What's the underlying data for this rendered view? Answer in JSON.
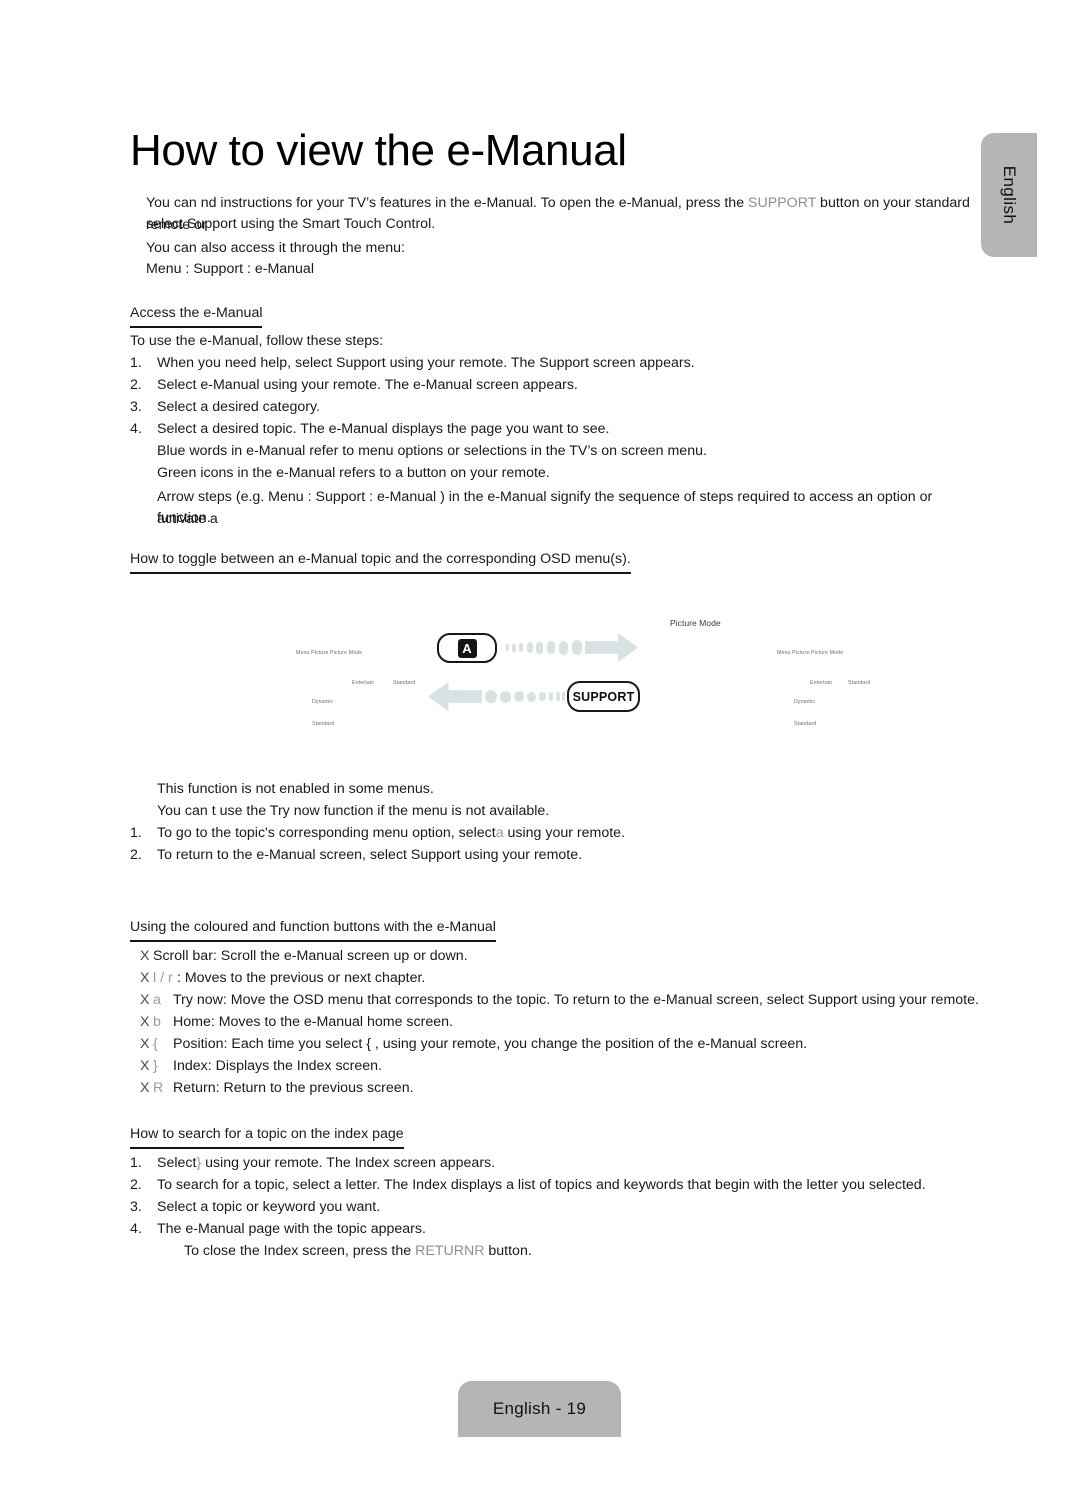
{
  "side_tab": {
    "label": "English"
  },
  "page_title": "How to view the e-Manual",
  "intro": {
    "line1_a": "You can  nd instructions for your TV",
    "line1_b": "s features in the e-Manual. To open the e-Manual, press the ",
    "line1_support": "SUPPORT",
    "line1_c": " button on your standard remote or",
    "line2": "select Support using the Smart Touch Control.",
    "line3": "You can also access it through the menu:",
    "line4": "Menu  : Support  : e-Manual"
  },
  "section_access": {
    "heading": "Access the  e-Manual",
    "lead": "To use the e-Manual, follow these steps:",
    "steps": [
      {
        "n": "1.",
        "text": "When you need help, select Support using your remote. The Support screen appears."
      },
      {
        "n": "2.",
        "text": "Select e-Manual using your remote. The e-Manual screen appears."
      },
      {
        "n": "3.",
        "text": "Select a desired category."
      },
      {
        "n": "4.",
        "text": "Select a desired topic. The e-Manual displays the page you want to see."
      }
    ],
    "notes": [
      "Blue words in e-Manual refer to menu options or selections in the TV’s on screen menu.",
      "Green icons in the e-Manual refers to a button on your remote."
    ],
    "arrow_note_line1": "Arrow steps (e.g. Menu : Support    : e-Manual  ) in the e-Manual signify the sequence of steps required to access an option or activate a",
    "arrow_note_line2": "function."
  },
  "section_toggle": {
    "heading": "How to toggle between an e-Manual topic and the corresponding OSD menu(s).",
    "notes": [
      "This function is not enabled in some menus.",
      "You can t use the Try now function if the menu is not available."
    ],
    "steps": [
      {
        "n": "1.",
        "text_a": "To go to the topic's corresponding menu option, select",
        "glyph": "a",
        "text_b": " using your remote."
      },
      {
        "n": "2.",
        "text_a": "To return to the e-Manual screen, select Support using your remote.",
        "glyph": "",
        "text_b": ""
      }
    ]
  },
  "diagram": {
    "left_screen": {
      "breadcrumb": "Menu   Picture   Picture Mode",
      "row1_a": "Entertain",
      "row1_b": "Standard",
      "row2": "Dynamic",
      "row3": "Standard"
    },
    "right_screen": {
      "title": "Picture Mode",
      "breadcrumb": "Menu    Picture    Picture Mode",
      "row1_a": "Entertain",
      "row1_b": "Standard",
      "row2": "Dynamic",
      "row3": "Standard"
    },
    "key_a": "A",
    "key_support": "SUPPORT",
    "arrow_color": "#d9e2e2"
  },
  "section_buttons": {
    "heading": "Using the coloured and function buttons with the e-Manual",
    "items": [
      {
        "x": "X",
        "key": "",
        "text": "Scroll bar: Scroll the e-Manual screen up or down."
      },
      {
        "x": "X",
        "key": "l  / r",
        "text": " : Moves to the previous or next chapter."
      },
      {
        "x": "X",
        "key": "a",
        "text": "Try now: Move the OSD menu that corresponds to the topic. To return to the e-Manual screen, select Support using your remote."
      },
      {
        "x": "X",
        "key": "b",
        "text": "Home: Moves to the e-Manual home screen."
      },
      {
        "x": "X",
        "key": "{",
        "text": "Position: Each time you select {  , using your remote, you change the position of the e-Manual screen."
      },
      {
        "x": "X",
        "key": "}",
        "text": "Index: Displays the Index screen."
      },
      {
        "x": "X",
        "key": "R",
        "text": "Return: Return to the previous screen."
      }
    ]
  },
  "section_index": {
    "heading": "How to search for a topic on the index page",
    "steps": [
      {
        "n": "1.",
        "text_a": "Select",
        "glyph": "}",
        "text_b": "  using your remote. The Index screen appears."
      },
      {
        "n": "2.",
        "text_a": "To search for a topic, select a letter. The Index displays a list of topics and keywords that begin with the letter you selected.",
        "glyph": "",
        "text_b": ""
      },
      {
        "n": "3.",
        "text_a": "Select a topic or keyword you want.",
        "glyph": "",
        "text_b": ""
      },
      {
        "n": "4.",
        "text_a": "The e-Manual page with the topic appears.",
        "glyph": "",
        "text_b": ""
      }
    ],
    "closing_a": "To close the Index screen, press the ",
    "closing_key": "RETURN",
    "closing_glyph": "R",
    "closing_b": "  button."
  },
  "footer": {
    "label": "English - 19"
  }
}
